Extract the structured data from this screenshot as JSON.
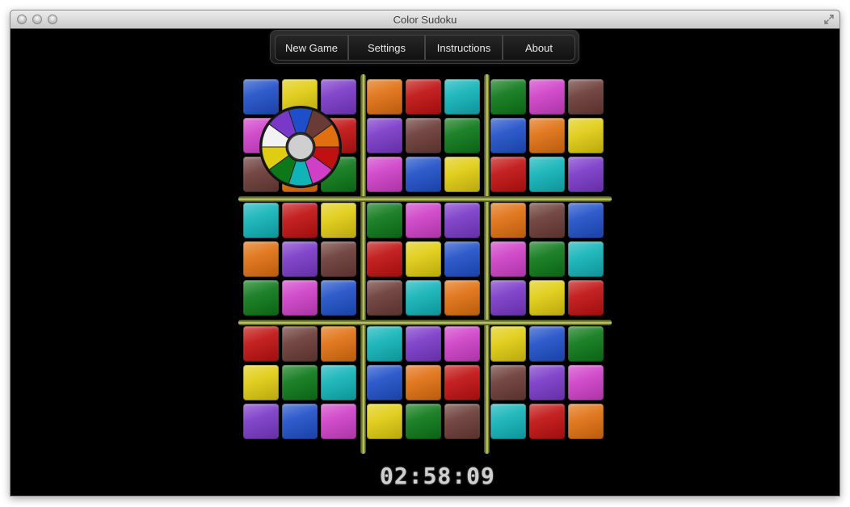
{
  "window": {
    "title": "Color Sudoku"
  },
  "menu": [
    {
      "id": "new-game",
      "label": "New Game"
    },
    {
      "id": "settings",
      "label": "Settings"
    },
    {
      "id": "instructions",
      "label": "Instructions"
    },
    {
      "id": "about",
      "label": "About"
    }
  ],
  "palette": {
    "B": "#1f4fc8",
    "Y": "#e0cc10",
    "P": "#7a38c8",
    "O": "#e06f10",
    "R": "#c01010",
    "C": "#10b3b8",
    "G": "#0c7818",
    "M": "#cf3fc8",
    "N": "#6a3a36"
  },
  "board": [
    [
      "B",
      "Y",
      "P",
      "O",
      "R",
      "C",
      "G",
      "M",
      "N"
    ],
    [
      "M",
      "Y",
      "R",
      "P",
      "N",
      "G",
      "B",
      "O",
      "Y"
    ],
    [
      "N",
      "O",
      "G",
      "M",
      "B",
      "Y",
      "R",
      "C",
      "P"
    ],
    [
      "C",
      "R",
      "Y",
      "G",
      "M",
      "P",
      "O",
      "N",
      "B"
    ],
    [
      "O",
      "P",
      "N",
      "R",
      "Y",
      "B",
      "M",
      "G",
      "C"
    ],
    [
      "G",
      "M",
      "B",
      "N",
      "C",
      "O",
      "P",
      "Y",
      "R"
    ],
    [
      "R",
      "N",
      "O",
      "C",
      "P",
      "M",
      "Y",
      "B",
      "G"
    ],
    [
      "Y",
      "G",
      "C",
      "B",
      "O",
      "R",
      "N",
      "P",
      "M"
    ],
    [
      "P",
      "B",
      "M",
      "Y",
      "G",
      "N",
      "C",
      "R",
      "O"
    ]
  ],
  "color_wheel": {
    "segments": [
      "N",
      "O",
      "R",
      "M",
      "C",
      "G",
      "Y",
      "W",
      "P",
      "B"
    ],
    "white": "#f2f2f2"
  },
  "timer": "02:58:09"
}
